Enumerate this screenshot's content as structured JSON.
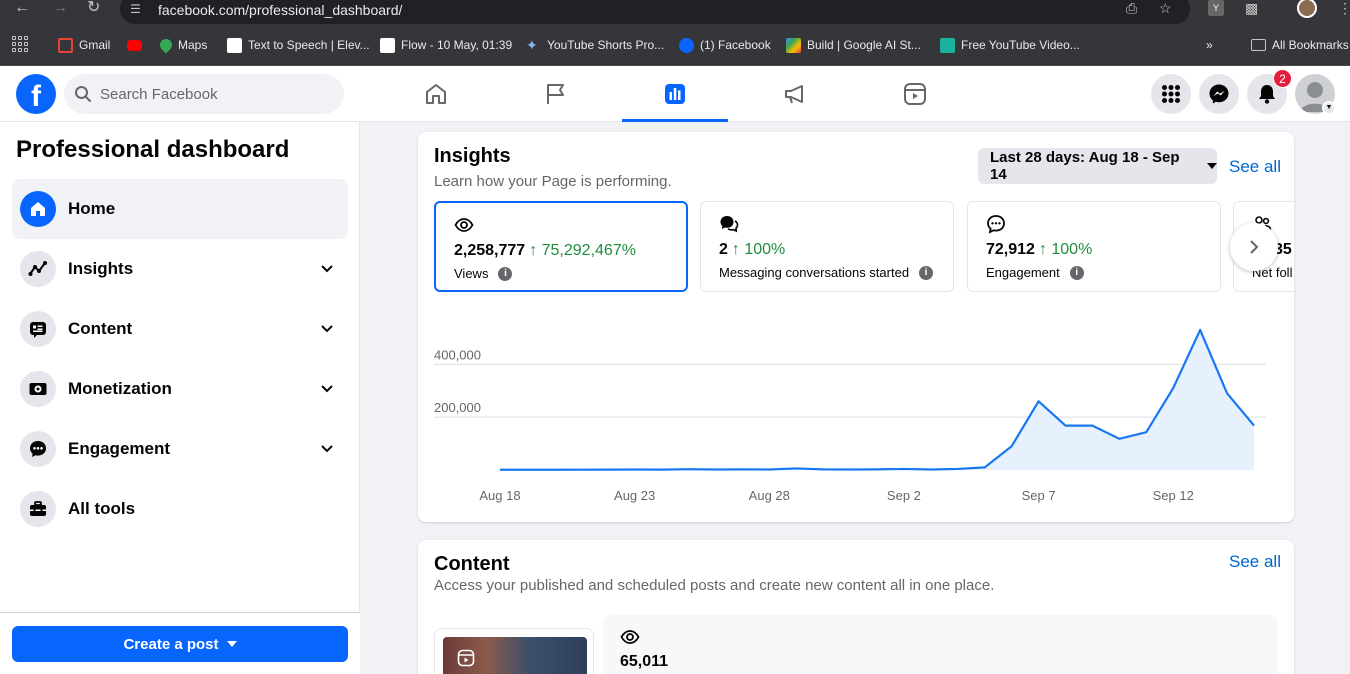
{
  "browser": {
    "url": "facebook.com/professional_dashboard/",
    "bookmarks": [
      {
        "label": "Gmail",
        "color": "#ea4335"
      },
      {
        "label": "",
        "color": "#ff0000"
      },
      {
        "label": "Maps",
        "color": "#34a853"
      },
      {
        "label": "Text to Speech | Elev...",
        "color": "#ffffff"
      },
      {
        "label": "Flow - 10 May, 01:39",
        "color": "#ffffff"
      },
      {
        "label": "YouTube Shorts Pro...",
        "color": "#8ab4f8"
      },
      {
        "label": "(1) Facebook",
        "color": "#0866ff"
      },
      {
        "label": "Build | Google AI St...",
        "color": "#4285f4"
      },
      {
        "label": "Free YouTube Video...",
        "color": "#1bb39d"
      }
    ],
    "overflow_label": "»",
    "all_bookmarks": "All Bookmarks",
    "ext_badge": "Y"
  },
  "header": {
    "search_placeholder": "Search Facebook",
    "notification_count": "2"
  },
  "sidebar": {
    "title": "Professional dashboard",
    "items": [
      {
        "label": "Home",
        "icon": "home-icon",
        "active": true,
        "expandable": false
      },
      {
        "label": "Insights",
        "icon": "insights-icon",
        "active": false,
        "expandable": true
      },
      {
        "label": "Content",
        "icon": "content-icon",
        "active": false,
        "expandable": true
      },
      {
        "label": "Monetization",
        "icon": "monetization-icon",
        "active": false,
        "expandable": true
      },
      {
        "label": "Engagement",
        "icon": "engagement-icon",
        "active": false,
        "expandable": true
      },
      {
        "label": "All tools",
        "icon": "tools-icon",
        "active": false,
        "expandable": false
      }
    ],
    "create_post": "Create a post"
  },
  "insights": {
    "title": "Insights",
    "subtitle": "Learn how your Page is performing.",
    "date_range": "Last 28 days: Aug 18 - Sep 14",
    "see_all": "See all",
    "metrics": [
      {
        "value": "2,258,777",
        "change": "↑ 75,292,467%",
        "label": "Views",
        "icon": "eye-icon"
      },
      {
        "value": "2",
        "change": "↑ 100%",
        "label": "Messaging conversations started",
        "icon": "chat-icon"
      },
      {
        "value": "72,912",
        "change": "↑ 100%",
        "label": "Engagement",
        "icon": "engagement-bubble-icon"
      },
      {
        "value": "35",
        "change": "",
        "label": "Net foll",
        "icon": "followers-icon"
      }
    ]
  },
  "chart_data": {
    "type": "area",
    "x": [
      "Aug 18",
      "Aug 19",
      "Aug 20",
      "Aug 21",
      "Aug 22",
      "Aug 23",
      "Aug 24",
      "Aug 25",
      "Aug 26",
      "Aug 27",
      "Aug 28",
      "Aug 29",
      "Aug 30",
      "Aug 31",
      "Sep 1",
      "Sep 2",
      "Sep 3",
      "Sep 4",
      "Sep 5",
      "Sep 6",
      "Sep 7",
      "Sep 8",
      "Sep 9",
      "Sep 10",
      "Sep 11",
      "Sep 12",
      "Sep 13",
      "Sep 14"
    ],
    "xticks": [
      "Aug 18",
      "Aug 23",
      "Aug 28",
      "Sep 2",
      "Sep 7",
      "Sep 12"
    ],
    "yticks": [
      200000,
      400000
    ],
    "ytick_labels": [
      "200,000",
      "400,000"
    ],
    "values": [
      1000,
      1000,
      1000,
      1200,
      1500,
      2000,
      1500,
      3000,
      2000,
      2500,
      2000,
      6000,
      2500,
      2000,
      2500,
      4000,
      2000,
      4000,
      10000,
      90000,
      260000,
      168000,
      168000,
      118000,
      143000,
      310000,
      530000,
      290000,
      168000
    ],
    "ylim": [
      0,
      560000
    ],
    "color": "#1877f2",
    "fill": "#e7f0fd",
    "grid": true
  },
  "content_section": {
    "title": "Content",
    "subtitle": "Access your published and scheduled posts and create new content all in one place.",
    "see_all": "See all",
    "first_post_views": "65,011"
  }
}
